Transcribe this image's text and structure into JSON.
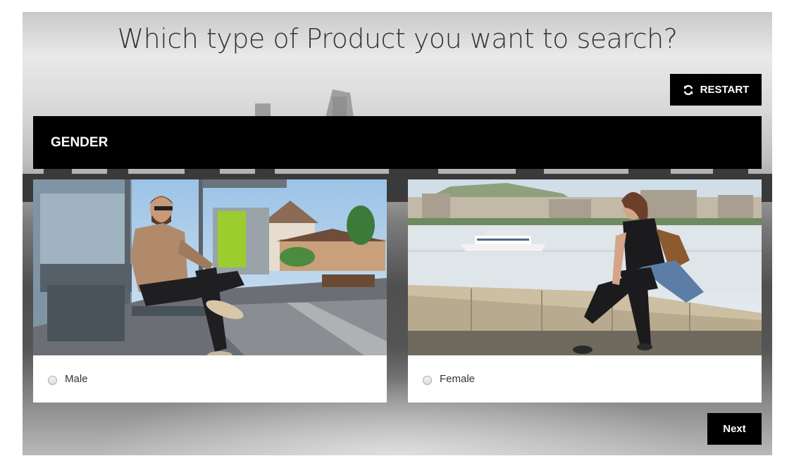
{
  "quiz": {
    "question_title": "Which type of Product you want to search?",
    "restart_label": "RESTART",
    "restart_icon": "refresh-icon",
    "step_heading": "GENDER",
    "next_label": "Next",
    "options": [
      {
        "label": "Male",
        "selected": false,
        "photo": "man-sitting-at-bus-stop"
      },
      {
        "label": "Female",
        "selected": false,
        "photo": "woman-sitting-on-riverside-wall"
      }
    ]
  },
  "colors": {
    "button_bg": "#000000",
    "button_text": "#ffffff",
    "card_bg": "#ffffff",
    "title_text": "#333333"
  }
}
